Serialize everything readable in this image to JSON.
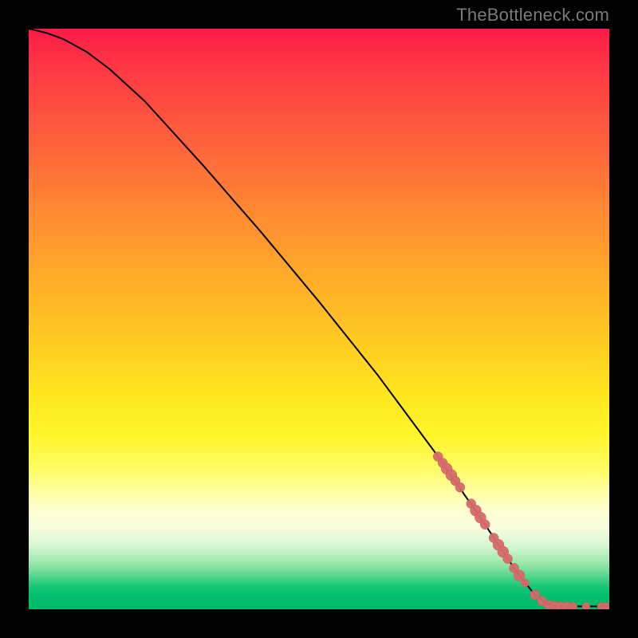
{
  "attribution": "TheBottleneck.com",
  "colors": {
    "curve": "#000000",
    "marker_fill": "#d66a6a",
    "marker_stroke": "#c95b5b",
    "frame": "#000000"
  },
  "chart_data": {
    "type": "line",
    "title": "",
    "xlabel": "",
    "ylabel": "",
    "xlim": [
      0,
      100
    ],
    "ylim": [
      0,
      100
    ],
    "grid": false,
    "curve": [
      {
        "x": 0,
        "y": 100
      },
      {
        "x": 3,
        "y": 99.3
      },
      {
        "x": 6,
        "y": 98.2
      },
      {
        "x": 10,
        "y": 96.0
      },
      {
        "x": 14,
        "y": 93.0
      },
      {
        "x": 20,
        "y": 87.5
      },
      {
        "x": 30,
        "y": 76.5
      },
      {
        "x": 40,
        "y": 65.0
      },
      {
        "x": 50,
        "y": 53.0
      },
      {
        "x": 60,
        "y": 40.5
      },
      {
        "x": 70,
        "y": 27.0
      },
      {
        "x": 78,
        "y": 15.5
      },
      {
        "x": 84,
        "y": 6.5
      },
      {
        "x": 87,
        "y": 2.7
      },
      {
        "x": 89,
        "y": 1.2
      },
      {
        "x": 91,
        "y": 0.5
      },
      {
        "x": 100,
        "y": 0.5
      }
    ],
    "markers": [
      {
        "x": 70.5,
        "y": 26.3,
        "r": 6
      },
      {
        "x": 71.3,
        "y": 25.2,
        "r": 6
      },
      {
        "x": 72.0,
        "y": 24.2,
        "r": 7
      },
      {
        "x": 72.8,
        "y": 23.1,
        "r": 7
      },
      {
        "x": 73.5,
        "y": 22.1,
        "r": 6
      },
      {
        "x": 74.3,
        "y": 21.0,
        "r": 6
      },
      {
        "x": 76.2,
        "y": 18.2,
        "r": 6
      },
      {
        "x": 77.0,
        "y": 17.0,
        "r": 7
      },
      {
        "x": 77.8,
        "y": 15.8,
        "r": 7
      },
      {
        "x": 78.6,
        "y": 14.6,
        "r": 6
      },
      {
        "x": 80.1,
        "y": 12.3,
        "r": 6
      },
      {
        "x": 80.9,
        "y": 11.1,
        "r": 7
      },
      {
        "x": 81.7,
        "y": 9.9,
        "r": 7
      },
      {
        "x": 82.5,
        "y": 8.7,
        "r": 6
      },
      {
        "x": 83.6,
        "y": 7.1,
        "r": 6
      },
      {
        "x": 84.5,
        "y": 5.8,
        "r": 7
      },
      {
        "x": 85.5,
        "y": 4.5,
        "r": 5
      },
      {
        "x": 87.2,
        "y": 2.5,
        "r": 6
      },
      {
        "x": 88.4,
        "y": 1.4,
        "r": 6
      },
      {
        "x": 89.6,
        "y": 0.7,
        "r": 6
      },
      {
        "x": 90.6,
        "y": 0.55,
        "r": 6
      },
      {
        "x": 91.6,
        "y": 0.5,
        "r": 6
      },
      {
        "x": 92.7,
        "y": 0.5,
        "r": 6
      },
      {
        "x": 93.8,
        "y": 0.5,
        "r": 5
      },
      {
        "x": 96.0,
        "y": 0.5,
        "r": 5
      },
      {
        "x": 98.6,
        "y": 0.5,
        "r": 5
      },
      {
        "x": 99.5,
        "y": 0.5,
        "r": 5
      }
    ]
  }
}
